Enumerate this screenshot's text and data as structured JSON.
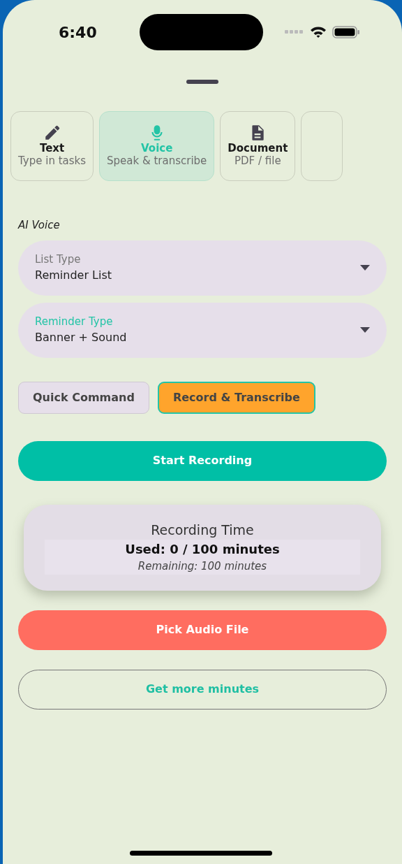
{
  "status_bar": {
    "time": "6:40"
  },
  "tabs": [
    {
      "kind": "text",
      "title": "Text",
      "subtitle": "Type in tasks",
      "selected": false
    },
    {
      "kind": "voice",
      "title": "Voice",
      "subtitle": "Speak & transcribe",
      "selected": true
    },
    {
      "kind": "document",
      "title": "Document",
      "subtitle": "PDF / file",
      "selected": false
    },
    {
      "kind": "more",
      "selected": false
    }
  ],
  "section_label": "AI Voice",
  "dropdowns": [
    {
      "label": "List Type",
      "value": "Reminder List",
      "focused": false
    },
    {
      "label": "Reminder Type",
      "value": "Banner + Sound",
      "focused": true
    }
  ],
  "modes": [
    {
      "label": "Quick Command",
      "selected": false
    },
    {
      "label": "Record & Transcribe",
      "selected": true
    }
  ],
  "start_button": "Start Recording",
  "usage_card": {
    "title": "Recording Time",
    "used": "Used: 0 / 100 minutes",
    "remaining": "Remaining: 100 minutes"
  },
  "pick_button": "Pick Audio File",
  "more_button": "Get more minutes"
}
